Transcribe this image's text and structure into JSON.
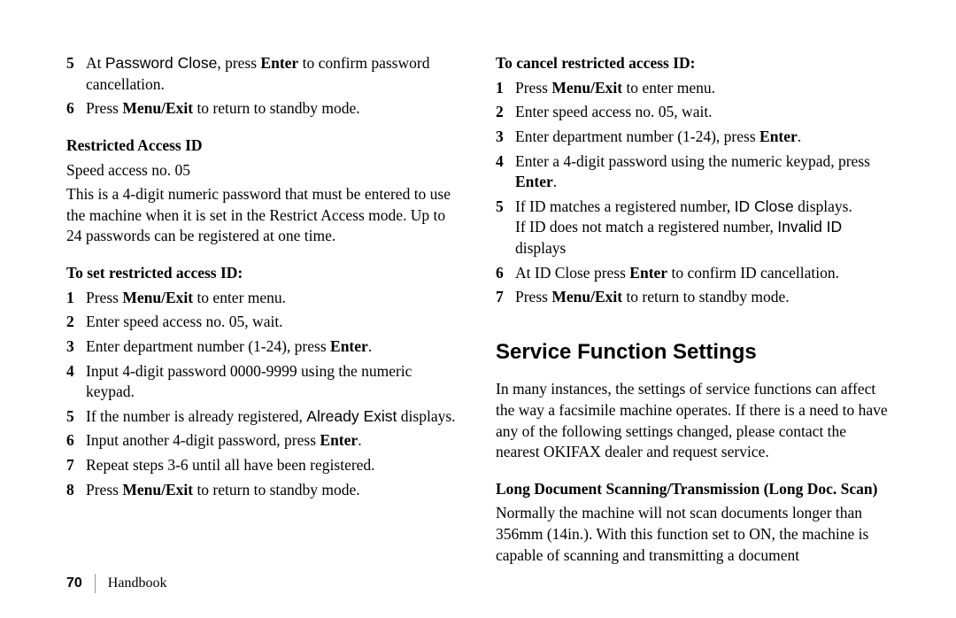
{
  "left": {
    "cont_items": [
      {
        "num": "5",
        "pre": "At ",
        "disp": "Password Close",
        "mid": ", press ",
        "bold": "Enter",
        "post": " to confirm password cancellation."
      },
      {
        "num": "6",
        "pre": "Press ",
        "bold": "Menu/Exit",
        "post": " to return to standby mode."
      }
    ],
    "section_title": "Restricted Access ID",
    "speed_line": "Speed access no. 05",
    "desc": "This is a 4-digit numeric password that must be entered to use the machine when it is set in the Restrict Access mode. Up to 24 passwords can be registered at one time.",
    "set_title": "To set restricted access ID:",
    "set_items": [
      {
        "num": "1",
        "pre": "Press ",
        "bold": "Menu/Exit",
        "post": " to enter menu."
      },
      {
        "num": "2",
        "text": "Enter speed access no. 05, wait."
      },
      {
        "num": "3",
        "pre": "Enter department number (1-24), press ",
        "bold": "Enter",
        "post": "."
      },
      {
        "num": "4",
        "text": "Input 4-digit password 0000-9999 using the numeric keypad."
      },
      {
        "num": "5",
        "pre": "If the number is already registered, ",
        "disp": "Already Exist",
        "post": " displays."
      },
      {
        "num": "6",
        "pre": "Input another 4-digit password, press ",
        "bold": "Enter",
        "post": "."
      },
      {
        "num": "7",
        "text": "Repeat steps 3-6 until all have been registered."
      },
      {
        "num": "8",
        "pre": "Press ",
        "bold": "Menu/Exit",
        "post": " to return to standby mode."
      }
    ]
  },
  "right": {
    "cancel_title": "To cancel restricted access ID:",
    "cancel_items_a": [
      {
        "num": "1",
        "pre": "Press ",
        "bold": "Menu/Exit",
        "post": " to enter menu."
      },
      {
        "num": "2",
        "text": "Enter speed access no. 05, wait."
      },
      {
        "num": "3",
        "pre": "Enter department number (1-24), press ",
        "bold": "Enter",
        "post": "."
      },
      {
        "num": "4",
        "pre": "Enter a 4-digit password using the numeric keypad, press ",
        "bold": "Enter",
        "post": "."
      }
    ],
    "item5": {
      "num": "5",
      "line1_pre": "If ID matches a registered number, ",
      "line1_disp": "ID Close",
      "line1_post": " displays.",
      "line2_pre": "If ID does not match a registered number, ",
      "line2_disp": "Invalid ID",
      "line2_post": " displays"
    },
    "cancel_items_b": [
      {
        "num": "6",
        "pre": "At ID Close press ",
        "bold": "Enter",
        "post": " to confirm ID cancellation."
      },
      {
        "num": "7",
        "pre": "Press ",
        "bold": "Menu/Exit",
        "post": " to return to standby mode."
      }
    ],
    "h2": "Service Function Settings",
    "service_para": "In many instances, the settings of service functions can affect the way a facsimile machine operates.  If there is a need to have any of the following settings changed, please contact the nearest OKIFAX dealer and request service.",
    "long_doc_title": "Long Document Scanning/Transmission (Long Doc. Scan)",
    "long_doc_para": "Normally the machine will not scan documents longer than 356mm (14in.).  With this function set to ON, the machine is capable of scanning and transmitting a document"
  },
  "footer": {
    "page": "70",
    "label": "Handbook"
  }
}
